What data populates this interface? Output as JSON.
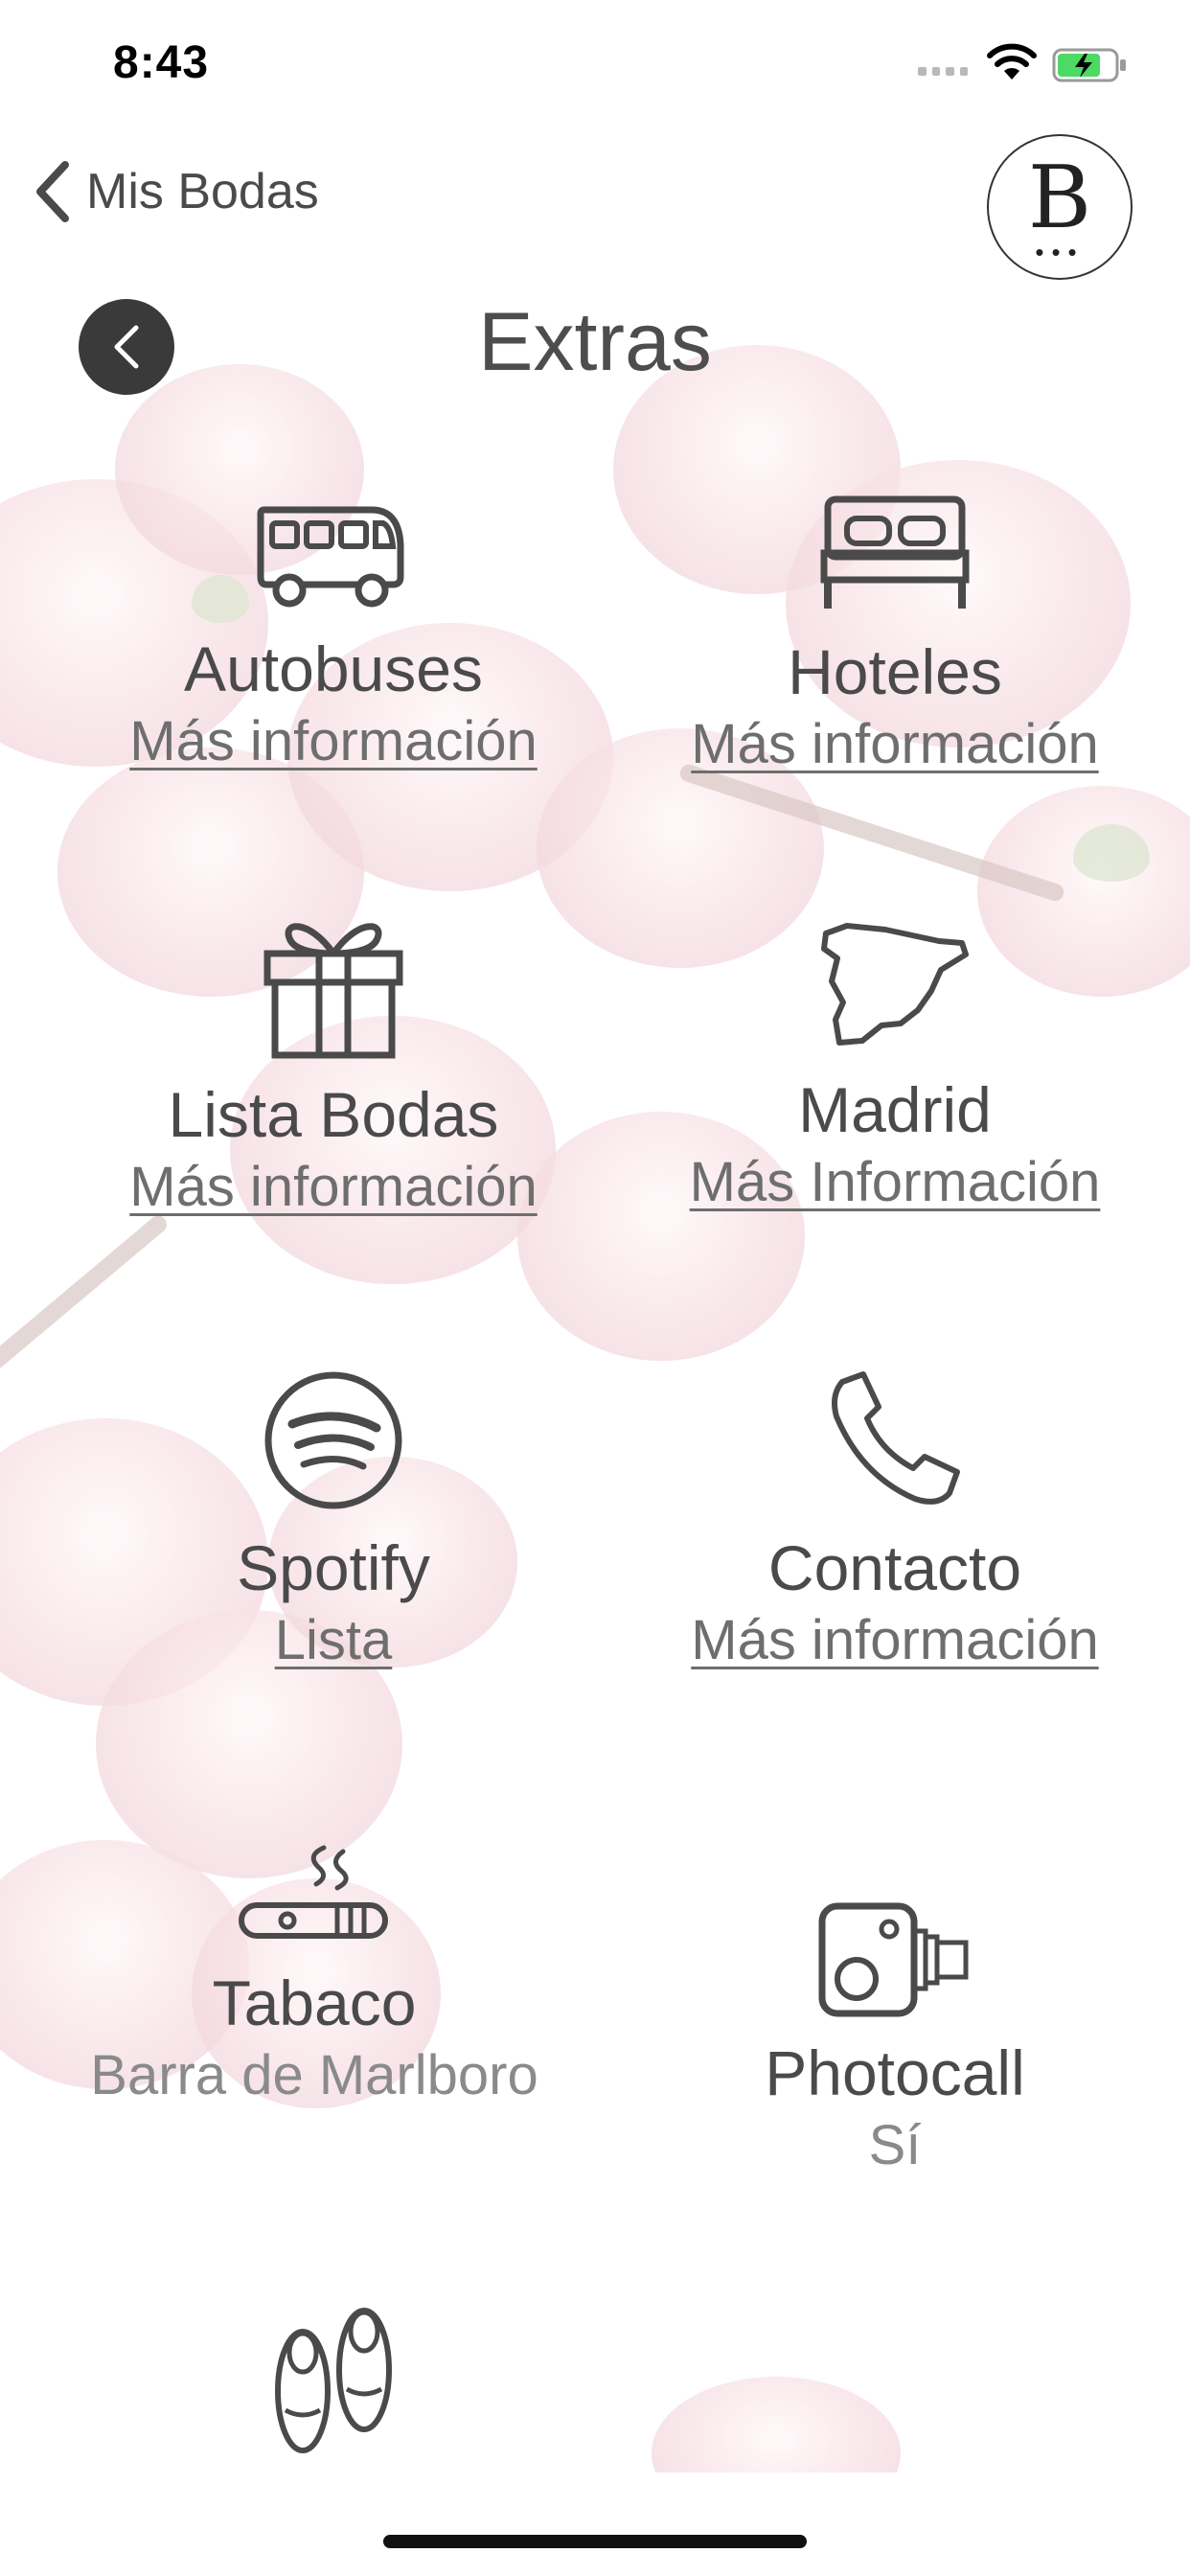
{
  "status_bar": {
    "time": "8:43"
  },
  "nav": {
    "back_label": "Mis Bodas",
    "logo_letter": "B",
    "logo_dots": "•••"
  },
  "page": {
    "title": "Extras"
  },
  "items": [
    {
      "name": "Autobuses",
      "detail": "Más información",
      "icon": "bus-icon"
    },
    {
      "name": "Hoteles",
      "detail": "Más información",
      "icon": "bed-icon"
    },
    {
      "name": "Lista Bodas",
      "detail": "Más información",
      "icon": "gift-icon"
    },
    {
      "name": "Madrid",
      "detail": "Más Información",
      "icon": "spain-map-icon"
    },
    {
      "name": "Spotify",
      "detail": "Lista",
      "icon": "spotify-icon"
    },
    {
      "name": "Contacto",
      "detail": "Más información",
      "icon": "phone-icon"
    },
    {
      "name": "Tabaco",
      "detail": "Barra de Marlboro",
      "icon": "cigar-icon"
    },
    {
      "name": "Photocall",
      "detail": "Sí",
      "icon": "camera-icon"
    },
    {
      "name": "",
      "detail": "",
      "icon": "ballet-shoes-icon"
    }
  ]
}
